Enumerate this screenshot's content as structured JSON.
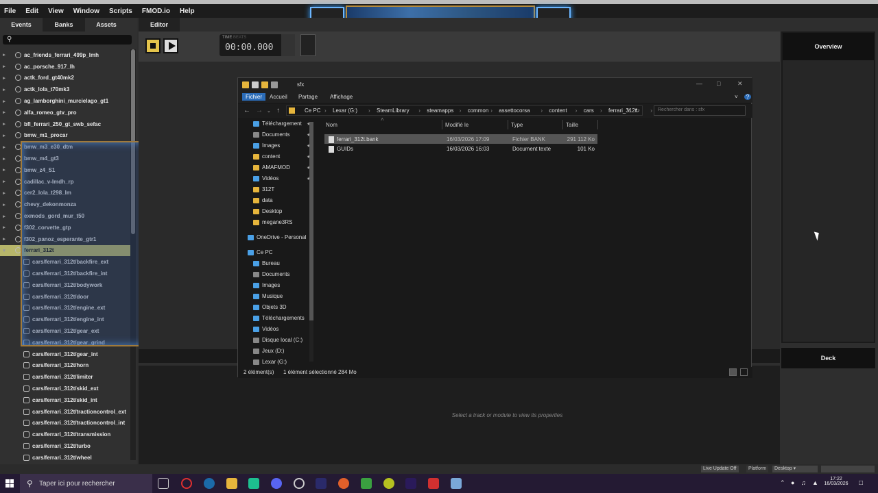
{
  "menu": [
    "File",
    "Edit",
    "View",
    "Window",
    "Scripts",
    "FMOD.io",
    "Help"
  ],
  "left_tabs": [
    "Events",
    "Banks",
    "Assets"
  ],
  "banks": [
    "ac_friends_ferrari_499p_lmh",
    "ac_porsche_917_lh",
    "actk_ford_gt40mk2",
    "actk_lola_t70mk3",
    "ag_lamborghini_murcielago_gt1",
    "alfa_romeo_gtv_pro",
    "bfl_ferrari_250_gt_swb_sefac",
    "bmw_m1_procar",
    "bmw_m3_e30_dtm",
    "bmw_m4_gt3",
    "bmw_z4_S1",
    "cadillac_v-lmdh_rp",
    "cer2_lola_t298_lm",
    "chevy_dekonmonza",
    "exmods_gord_mur_t50",
    "f302_corvette_gtp",
    "f302_panoz_esperante_gtr1"
  ],
  "selected_bank": "ferrari_312t",
  "bank_children": [
    "cars/ferrari_312t/backfire_ext",
    "cars/ferrari_312t/backfire_int",
    "cars/ferrari_312t/bodywork",
    "cars/ferrari_312t/door",
    "cars/ferrari_312t/engine_ext",
    "cars/ferrari_312t/engine_int",
    "cars/ferrari_312t/gear_ext",
    "cars/ferrari_312t/gear_grind",
    "cars/ferrari_312t/gear_int",
    "cars/ferrari_312t/horn",
    "cars/ferrari_312t/limiter",
    "cars/ferrari_312t/skid_ext",
    "cars/ferrari_312t/skid_int",
    "cars/ferrari_312t/tractioncontrol_ext",
    "cars/ferrari_312t/tractioncontrol_int",
    "cars/ferrari_312t/transmission",
    "cars/ferrari_312t/turbo",
    "cars/ferrari_312t/wheel"
  ],
  "editor": {
    "tab": "Editor",
    "time_label": "TIME",
    "beats_label": "BEATS",
    "time_value": "00:00.000",
    "hint": "Select a track or module to view its properties"
  },
  "overview_title": "Overview",
  "deck_title": "Deck",
  "status": {
    "live_update": "Live Update Off",
    "platform_label": "Platform",
    "platform_value": "Desktop"
  },
  "explorer": {
    "title": "sfx",
    "ribbon": [
      "Fichier",
      "Accueil",
      "Partage",
      "Affichage"
    ],
    "crumbs": [
      "Ce PC",
      "Lexar (G:)",
      "SteamLibrary",
      "steamapps",
      "common",
      "assettocorsa",
      "content",
      "cars",
      "ferrari_312t",
      "sfx"
    ],
    "search_placeholder": "Rechercher dans : sfx",
    "nav_items": [
      {
        "label": "Téléchargement",
        "icon": "download-icon",
        "pinned": true
      },
      {
        "label": "Documents",
        "icon": "documents-icon",
        "pinned": true
      },
      {
        "label": "Images",
        "icon": "images-icon",
        "pinned": true
      },
      {
        "label": "content",
        "icon": "folder-icon",
        "pinned": true
      },
      {
        "label": "AMAFMOD",
        "icon": "folder-icon",
        "pinned": true
      },
      {
        "label": "Vidéos",
        "icon": "videos-icon",
        "pinned": true
      },
      {
        "label": "312T",
        "icon": "folder-icon",
        "pinned": false
      },
      {
        "label": "data",
        "icon": "folder-icon",
        "pinned": false
      },
      {
        "label": "Desktop",
        "icon": "folder-icon",
        "pinned": false
      },
      {
        "label": "megane3RS",
        "icon": "folder-icon",
        "pinned": false
      },
      {
        "label": "OneDrive - Personal",
        "icon": "cloud-icon",
        "pinned": false
      },
      {
        "label": "Ce PC",
        "icon": "pc-icon",
        "pinned": false
      },
      {
        "label": "Bureau",
        "icon": "desktop-icon",
        "pinned": false
      },
      {
        "label": "Documents",
        "icon": "documents-icon",
        "pinned": false
      },
      {
        "label": "Images",
        "icon": "images-icon",
        "pinned": false
      },
      {
        "label": "Musique",
        "icon": "music-icon",
        "pinned": false
      },
      {
        "label": "Objets 3D",
        "icon": "3d-icon",
        "pinned": false
      },
      {
        "label": "Téléchargements",
        "icon": "download-icon",
        "pinned": false
      },
      {
        "label": "Vidéos",
        "icon": "videos-icon",
        "pinned": false
      },
      {
        "label": "Disque local (C:)",
        "icon": "drive-icon",
        "pinned": false
      },
      {
        "label": "Jeux (D:)",
        "icon": "drive-icon",
        "pinned": false
      },
      {
        "label": "Lexar (G:)",
        "icon": "drive-icon",
        "pinned": false
      }
    ],
    "columns": [
      "Nom",
      "Modifié le",
      "Type",
      "Taille"
    ],
    "files": [
      {
        "name": "ferrari_312t.bank",
        "modified": "16/03/2026 17:09",
        "type": "Fichier BANK",
        "size": "291 112 Ko",
        "selected": true
      },
      {
        "name": "GUIDs",
        "modified": "16/03/2026 16:03",
        "type": "Document texte",
        "size": "101 Ko",
        "selected": false
      }
    ],
    "status_count": "2 élément(s)",
    "status_sel": "1 élément sélectionné 284 Mo"
  },
  "taskbar": {
    "search_placeholder": "Taper ici pour rechercher",
    "time": "17:22",
    "date": "16/03/2026"
  }
}
